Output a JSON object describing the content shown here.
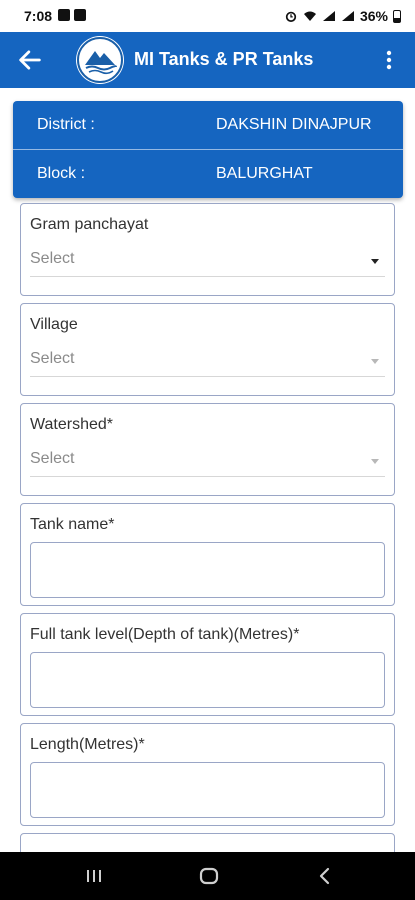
{
  "status_bar": {
    "time": "7:08",
    "battery": "36%",
    "icons": [
      "gallery-icon",
      "message-icon",
      "alarm-icon",
      "wifi-icon",
      "signal-icon",
      "signal-icon",
      "battery-icon"
    ]
  },
  "app_bar": {
    "title": "MI Tanks & PR Tanks",
    "back_icon": "arrow-left-icon",
    "menu_icon": "more-vertical-icon",
    "color": "#1565c0"
  },
  "info": {
    "district_label": "District :",
    "district_value": "DAKSHIN DINAJPUR",
    "block_label": "Block :",
    "block_value": "BALURGHAT"
  },
  "form": {
    "gram_panchayat": {
      "label": "Gram panchayat",
      "value": "Select"
    },
    "village": {
      "label": "Village",
      "value": "Select"
    },
    "watershed": {
      "label": "Watershed*",
      "value": "Select"
    },
    "tank_name": {
      "label": "Tank name*",
      "value": ""
    },
    "full_tank_level": {
      "label": "Full tank level(Depth of tank)(Metres)*",
      "value": ""
    },
    "length": {
      "label": "Length(Metres)*",
      "value": ""
    }
  },
  "nav_bar": {
    "icons": [
      "recent-apps-icon",
      "home-icon",
      "back-icon"
    ]
  }
}
